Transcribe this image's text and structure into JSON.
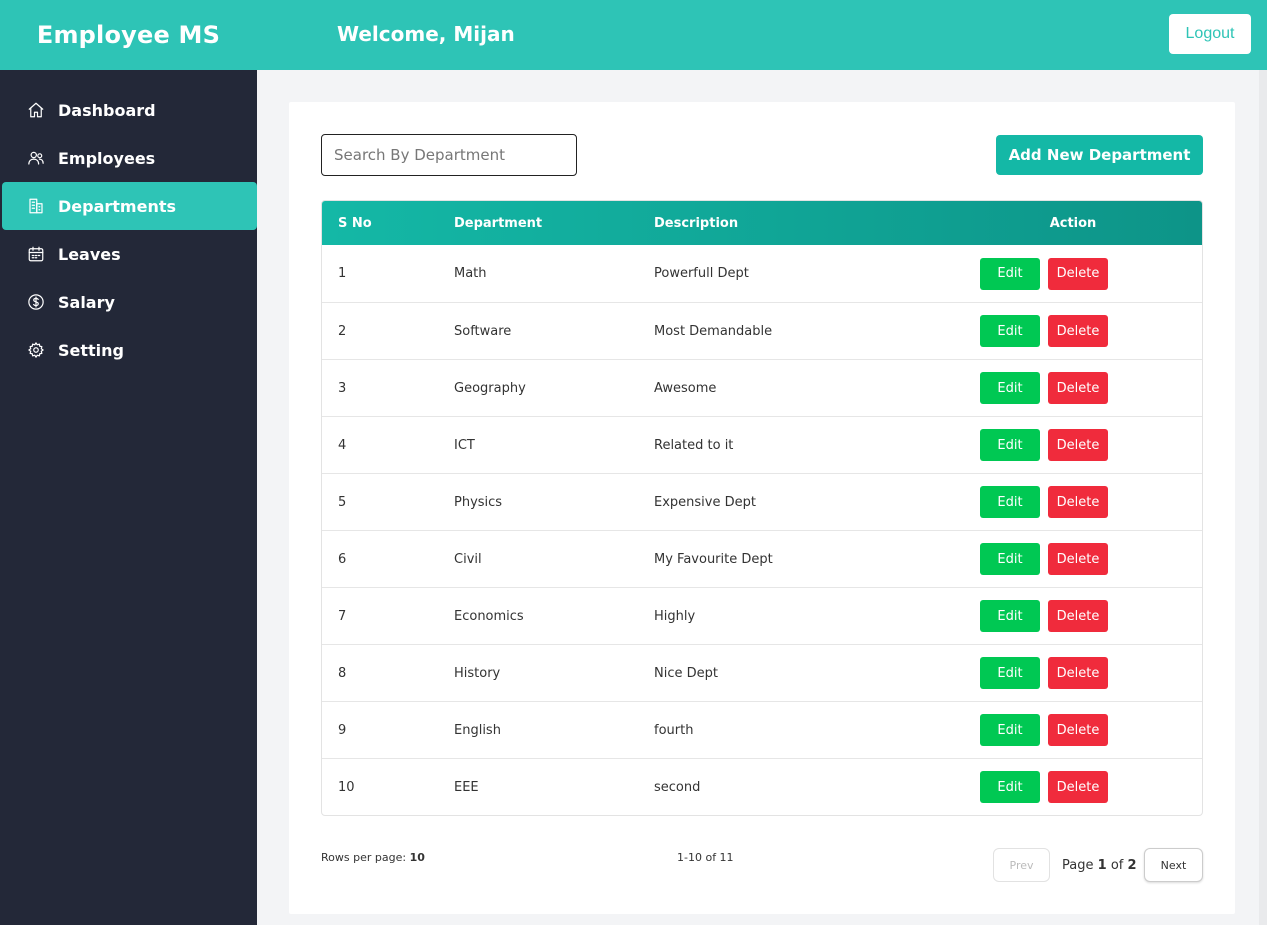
{
  "header": {
    "brand": "Employee MS",
    "welcome": "Welcome, Mijan",
    "logout_label": "Logout",
    "accent_color": "#2ec4b6"
  },
  "sidebar": {
    "items": [
      {
        "label": "Dashboard",
        "icon": "home-icon"
      },
      {
        "label": "Employees",
        "icon": "users-icon"
      },
      {
        "label": "Departments",
        "icon": "building-icon",
        "active": true
      },
      {
        "label": "Leaves",
        "icon": "calendar-icon"
      },
      {
        "label": "Salary",
        "icon": "dollar-icon"
      },
      {
        "label": "Setting",
        "icon": "gear-icon"
      }
    ]
  },
  "toolbar": {
    "search_placeholder": "Search By Department",
    "add_label": "Add New Department"
  },
  "table": {
    "headers": [
      "S No",
      "Department",
      "Description",
      "Action"
    ],
    "rows": [
      {
        "sno": "1",
        "dep": "Math",
        "desc": "Powerfull Dept"
      },
      {
        "sno": "2",
        "dep": "Software",
        "desc": "Most Demandable"
      },
      {
        "sno": "3",
        "dep": "Geography",
        "desc": "Awesome"
      },
      {
        "sno": "4",
        "dep": "ICT",
        "desc": "Related to it"
      },
      {
        "sno": "5",
        "dep": "Physics",
        "desc": "Expensive Dept"
      },
      {
        "sno": "6",
        "dep": "Civil",
        "desc": "My Favourite Dept"
      },
      {
        "sno": "7",
        "dep": "Economics",
        "desc": "Highly"
      },
      {
        "sno": "8",
        "dep": "History",
        "desc": "Nice Dept"
      },
      {
        "sno": "9",
        "dep": "English",
        "desc": "fourth"
      },
      {
        "sno": "10",
        "dep": "EEE",
        "desc": "second"
      }
    ],
    "edit_label": "Edit",
    "delete_label": "Delete"
  },
  "pagination": {
    "rows_per_page_label": "Rows per page:",
    "rows_per_page_value": "10",
    "range": "1-10 of 11",
    "prev_label": "Prev",
    "page_word": "Page",
    "current_page": "1",
    "of_word": "of",
    "total_pages": "2",
    "next_label": "Next"
  }
}
